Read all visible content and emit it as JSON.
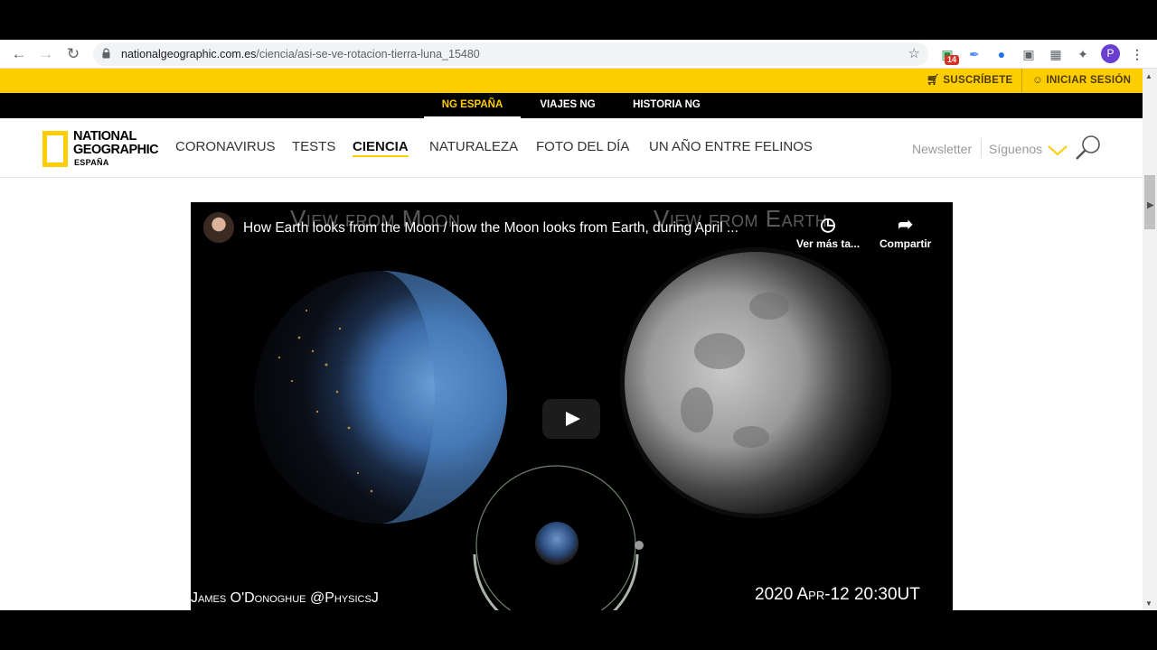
{
  "browser": {
    "url_host": "nationalgeographic.com.es",
    "url_path": "/ciencia/asi-se-ve-rotacion-tierra-luna_15480",
    "badge_count": "14",
    "profile_initial": "P"
  },
  "topbar": {
    "subscribe": "SUSCRÍBETE",
    "login": "INICIAR SESIÓN"
  },
  "network_nav": [
    {
      "label": "NG ESPAÑA",
      "active": true
    },
    {
      "label": "VIAJES NG",
      "active": false
    },
    {
      "label": "HISTORIA NG",
      "active": false
    }
  ],
  "logo": {
    "line1": "NATIONAL",
    "line2": "GEOGRAPHIC",
    "sub": "ESPAÑA"
  },
  "main_nav": [
    {
      "label": "CORONAVIRUS"
    },
    {
      "label": "TESTS"
    },
    {
      "label": "CIENCIA",
      "active": true
    },
    {
      "label": "NATURALEZA"
    },
    {
      "label": "FOTO DEL DÍA"
    },
    {
      "label": "UN AÑO ENTRE FELINOS"
    }
  ],
  "header_right": {
    "newsletter": "Newsletter",
    "follow": "Síguenos"
  },
  "video": {
    "title": "How Earth looks from the Moon / how the Moon looks from Earth, during April ...",
    "watch_later": "Ver más ta...",
    "share": "Compartir",
    "overlay_left": "View from Moon",
    "overlay_right": "View from Earth",
    "credit": "James O'Donoghue @PhysicsJ",
    "datetime": "2020 Apr-12 20:30UT"
  },
  "colors": {
    "brand_yellow": "#ffce00",
    "black": "#000000"
  }
}
